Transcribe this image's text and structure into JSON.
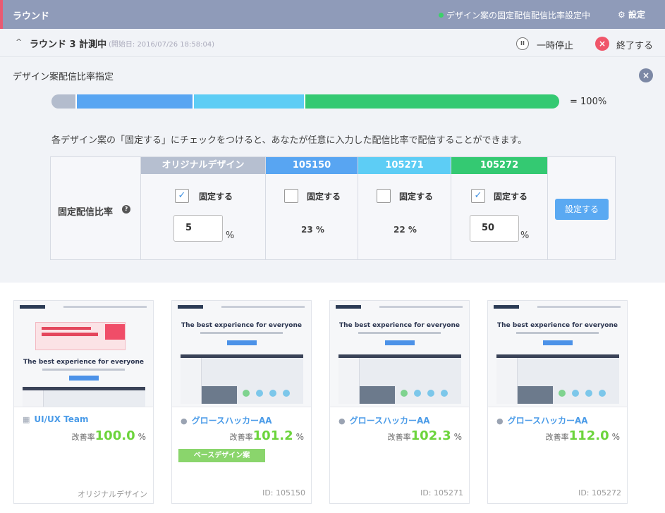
{
  "header": {
    "title": "ラウンド",
    "status": "デザイン案の固定配信配信比率設定中",
    "settings_label": "設定"
  },
  "round": {
    "title": "ラウンド 3 計測中",
    "started": "(開始日: 2016/07/26 18:58:04)",
    "pause_label": "一時停止",
    "stop_label": "終了する"
  },
  "ratio_panel": {
    "title": "デザイン案配信比率指定",
    "total": "= 100%",
    "description": "各デザイン案の「固定する」にチェックをつけると、あなたが任意に入力した配信比率で配信することができます。",
    "bar_segments": [
      {
        "color": "#b3bccd",
        "percent": 5
      },
      {
        "color": "#58a5f2",
        "percent": 23
      },
      {
        "color": "#5dcdf5",
        "percent": 22
      },
      {
        "color": "#34c972",
        "percent": 50
      }
    ]
  },
  "table": {
    "row_label": "固定配信比率",
    "check_label": "固定する",
    "pct_unit": "%",
    "set_button": "設定する",
    "columns": [
      {
        "header": "オリジナルデザイン",
        "color": "#b6bfd0",
        "checked": true,
        "check_mark": "✓",
        "input_value": "5"
      },
      {
        "header": "105150",
        "color": "#58a5f2",
        "checked": false,
        "check_mark": "",
        "value_text": "23 %"
      },
      {
        "header": "105271",
        "color": "#5dcdf5",
        "checked": false,
        "check_mark": "",
        "value_text": "22 %"
      },
      {
        "header": "105272",
        "color": "#34c972",
        "checked": true,
        "check_mark": "✓",
        "input_value": "50"
      }
    ]
  },
  "cards": [
    {
      "author": "UI/UX Team",
      "author_icon": "building-icon",
      "rate_label": "改善率",
      "rate": "100.0",
      "pct": "%",
      "footer": "オリジナルデザイン",
      "hero": "The best experience for everyone",
      "badge": ""
    },
    {
      "author": "グロースハッカーAA",
      "author_icon": "user-icon",
      "rate_label": "改善率",
      "rate": "101.2",
      "pct": "%",
      "footer": "ID: 105150",
      "hero": "The best experience for everyone",
      "badge": "ベースデザイン案"
    },
    {
      "author": "グロースハッカーAA",
      "author_icon": "user-icon",
      "rate_label": "改善率",
      "rate": "102.3",
      "pct": "%",
      "footer": "ID: 105271",
      "hero": "The best experience for everyone",
      "badge": ""
    },
    {
      "author": "グロースハッカーAA",
      "author_icon": "user-icon",
      "rate_label": "改善率",
      "rate": "112.0",
      "pct": "%",
      "footer": "ID: 105272",
      "hero": "The best experience for everyone",
      "badge": ""
    }
  ]
}
